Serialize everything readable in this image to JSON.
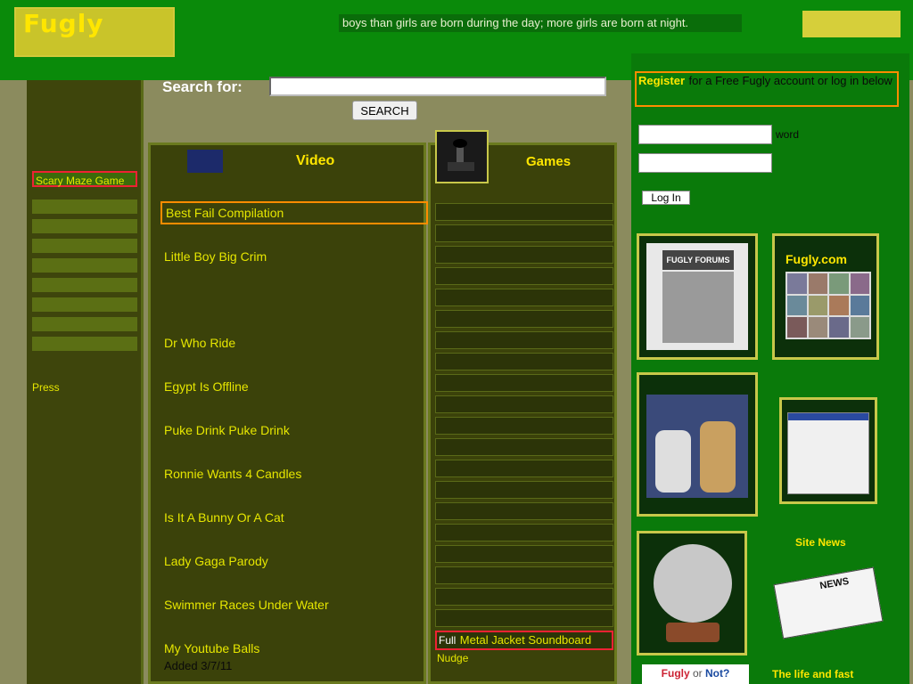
{
  "header": {
    "logo_text": "Fugly",
    "fact": "boys than girls are born during the day; more girls are born at night."
  },
  "search": {
    "label": "Search for:",
    "placeholder": "",
    "button": "SEARCH"
  },
  "left_nav": {
    "scary_button": "Scary Maze Game",
    "items": [
      "Press"
    ]
  },
  "video": {
    "heading": "Video",
    "links": [
      "Best Fail Compilation",
      "Little Boy Big Crim",
      "Dr Who Ride",
      "Egypt Is Offline",
      "Puke Drink Puke Drink",
      "Ronnie Wants 4 Candles",
      "Is It A Bunny Or A Cat",
      "Lady Gaga Parody",
      "Swimmer Races Under Water",
      "My Youtube Balls"
    ],
    "added": "Added 3/7/11"
  },
  "games": {
    "heading": "Games",
    "full_label": "Full",
    "last_game": "Metal Jacket Soundboard",
    "nudge": "Nudge"
  },
  "account": {
    "register_link": "Register",
    "register_text": "for a Free Fugly account or log in below",
    "password_label": "word",
    "login_button": "Log In"
  },
  "right_panels": {
    "fugly_site": "Fugly.com",
    "forums_label": "FUGLY FORUMS",
    "site_news": "Site News",
    "news_label": "NEWS",
    "life_fast": "The life and fast",
    "fugly_or_not_a": "Fugly",
    "fugly_or_not_or": " or ",
    "fugly_or_not_b": "Not?"
  },
  "colors": {
    "top_green": "#0a8a0a",
    "dark_olive": "#3b420a",
    "link_yellow": "#e6e600",
    "accent_orange": "#ff8c00"
  }
}
